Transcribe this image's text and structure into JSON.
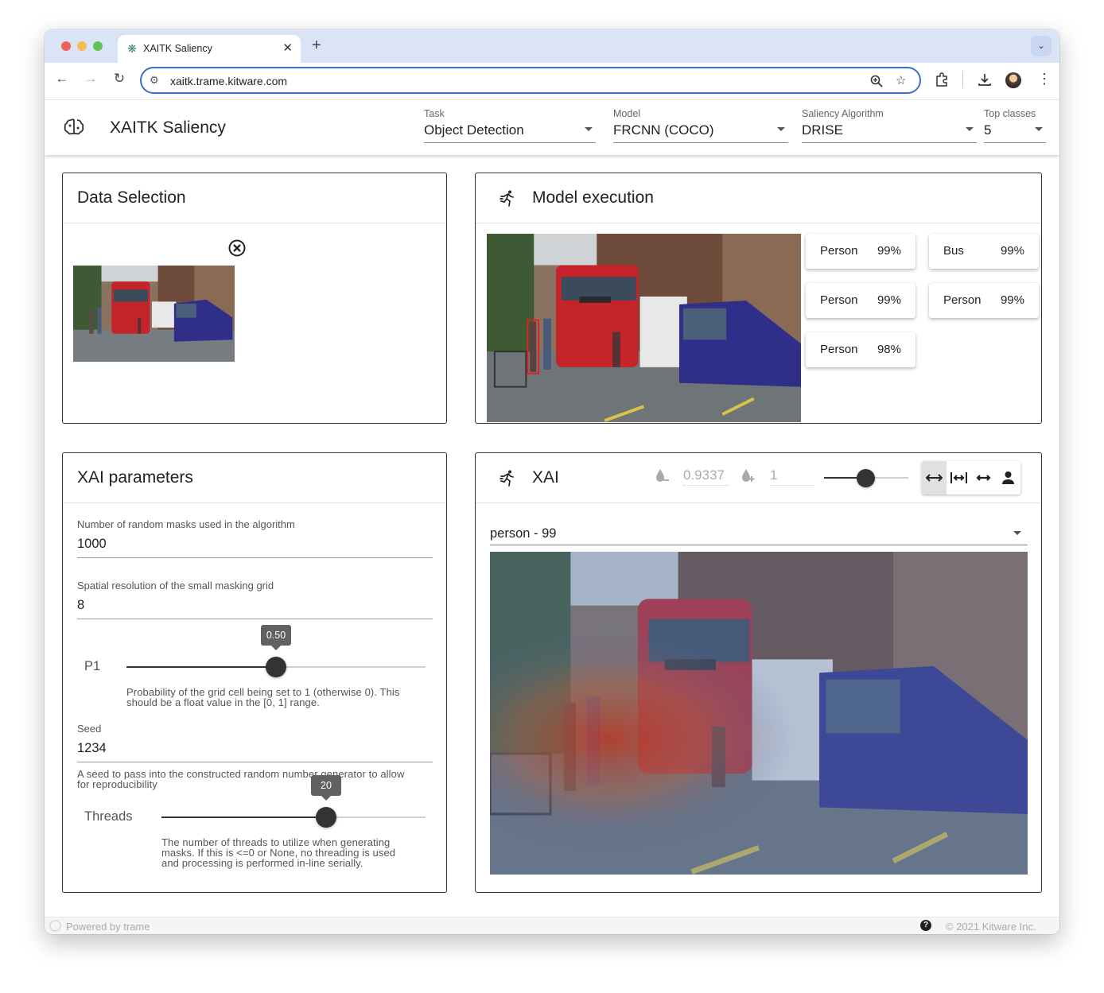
{
  "browser": {
    "tab_title": "XAITK Saliency",
    "url": "xaitk.trame.kitware.com"
  },
  "app": {
    "title": "XAITK Saliency",
    "selects": {
      "task": {
        "label": "Task",
        "value": "Object Detection"
      },
      "model": {
        "label": "Model",
        "value": "FRCNN (COCO)"
      },
      "saliency": {
        "label": "Saliency Algorithm",
        "value": "DRISE"
      },
      "top_classes": {
        "label": "Top classes",
        "value": "5"
      }
    }
  },
  "data_selection": {
    "title": "Data Selection"
  },
  "model_execution": {
    "title": "Model execution",
    "detections": [
      {
        "label": "Person",
        "score": "99%"
      },
      {
        "label": "Bus",
        "score": "99%"
      },
      {
        "label": "Person",
        "score": "99%"
      },
      {
        "label": "Person",
        "score": "99%"
      },
      {
        "label": "Person",
        "score": "98%"
      }
    ]
  },
  "xai_params": {
    "title": "XAI parameters",
    "masks": {
      "label": "Number of random masks used in the algorithm",
      "value": "1000"
    },
    "grid": {
      "label": "Spatial resolution of the small masking grid",
      "value": "8"
    },
    "p1": {
      "name": "P1",
      "value": 0.5,
      "tooltip": "0.50",
      "hint_line1": "Probability of the grid cell being set to 1 (otherwise 0). This",
      "hint_line2": "should be a float value in the [0, 1] range."
    },
    "seed": {
      "label": "Seed",
      "value": "1234",
      "hint_line1": "A seed to pass into the constructed random number generator to allow",
      "hint_line2": "for reproducibility"
    },
    "threads": {
      "name": "Threads",
      "value": 20,
      "tooltip": "20",
      "fraction": 0.6,
      "hint_line1": "The number of threads to utilize when generating",
      "hint_line2": "masks. If this is <=0 or None, no threading is used",
      "hint_line3": "and processing is performed in-line serially."
    }
  },
  "xai": {
    "title": "XAI",
    "min_value": "0.9337",
    "max_value": "1",
    "opacity_fraction": 0.5,
    "class_select": "person - 99",
    "colors": {
      "selected_toggle_bg": "#e0e0e0"
    }
  },
  "footer": {
    "powered": "Powered by trame",
    "copyright": "© 2021 Kitware Inc."
  }
}
